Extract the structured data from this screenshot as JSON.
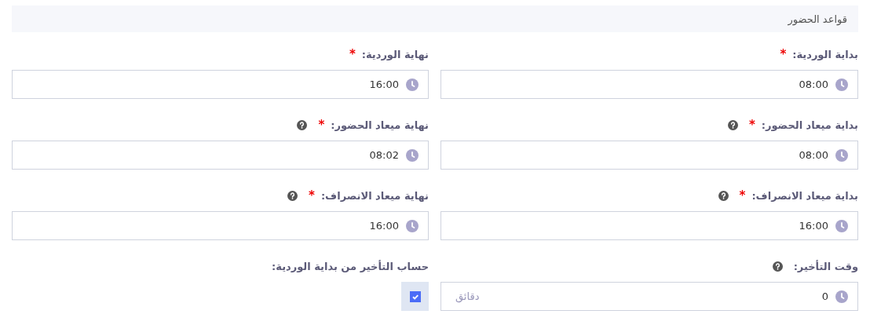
{
  "section": {
    "title": "قواعد الحضور"
  },
  "fields": [
    {
      "kind": "time",
      "label": "بداية الوردية:",
      "required_mark": "*",
      "help": false,
      "value": "08:00"
    },
    {
      "kind": "time",
      "label": "نهاية الوردية:",
      "required_mark": "*",
      "help": false,
      "value": "16:00"
    },
    {
      "kind": "time",
      "label": "بداية ميعاد الحضور:",
      "required_mark": "*",
      "help": true,
      "value": "08:00"
    },
    {
      "kind": "time",
      "label": "نهاية ميعاد الحضور:",
      "required_mark": "*",
      "help": true,
      "value": "08:02"
    },
    {
      "kind": "time",
      "label": "بداية ميعاد الانصراف:",
      "required_mark": "*",
      "help": true,
      "value": "16:00"
    },
    {
      "kind": "time",
      "label": "نهاية ميعاد الانصراف:",
      "required_mark": "*",
      "help": true,
      "value": "16:00"
    },
    {
      "kind": "time",
      "label": "وقت التأخير:",
      "help": true,
      "value": "0",
      "unit": "دقائق"
    },
    {
      "kind": "checkbox",
      "label": "حساب التأخير من بداية الوردية:",
      "help": false,
      "checked": true
    }
  ]
}
